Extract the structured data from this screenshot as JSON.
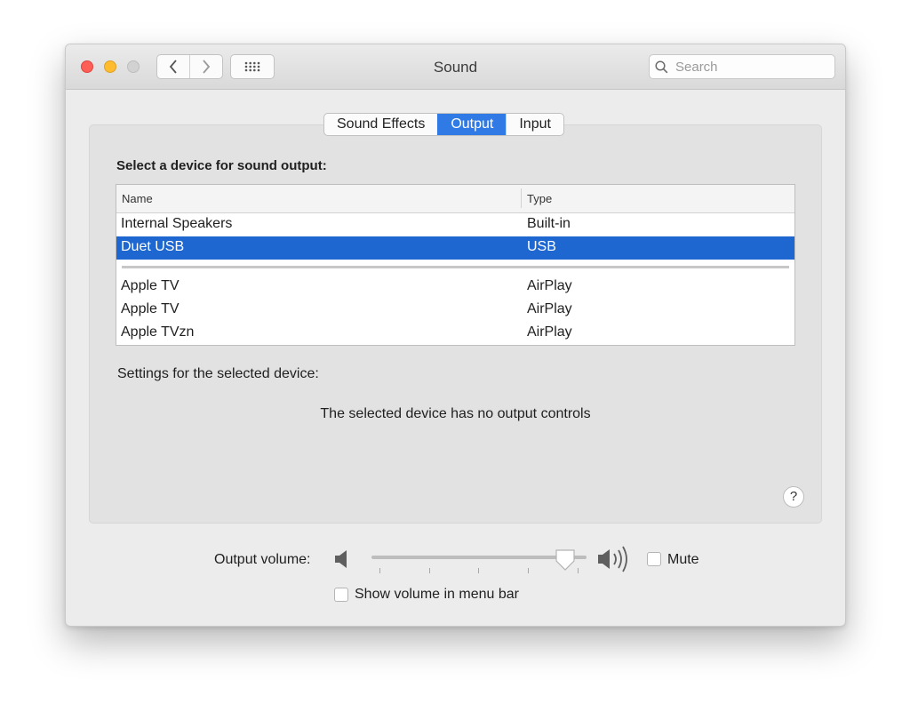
{
  "window": {
    "title": "Sound"
  },
  "toolbar": {
    "search_placeholder": "Search"
  },
  "tabs": [
    {
      "label": "Sound Effects",
      "active": false
    },
    {
      "label": "Output",
      "active": true
    },
    {
      "label": "Input",
      "active": false
    }
  ],
  "output": {
    "section_label": "Select a device for sound output:",
    "columns": {
      "name": "Name",
      "type": "Type"
    },
    "devices": [
      {
        "name": "Internal Speakers",
        "type": "Built-in",
        "selected": false
      },
      {
        "name": "Duet USB",
        "type": "USB",
        "selected": true
      },
      {
        "name": "Apple TV",
        "type": "AirPlay",
        "selected": false
      },
      {
        "name": "Apple TV",
        "type": "AirPlay",
        "selected": false
      },
      {
        "name": "Apple TVzn",
        "type": "AirPlay",
        "selected": false
      }
    ],
    "settings_label": "Settings for the selected device:",
    "no_controls_message": "The selected device has no output controls",
    "help_label": "?"
  },
  "volume": {
    "label": "Output volume:",
    "level": 0.9,
    "mute_label": "Mute",
    "mute_checked": false,
    "show_in_menu_label": "Show volume in menu bar",
    "show_in_menu_checked": false
  },
  "colors": {
    "accent": "#2f7ae5",
    "selection": "#1e67d1",
    "close": "#fd5f57",
    "minimize": "#febc2e"
  }
}
